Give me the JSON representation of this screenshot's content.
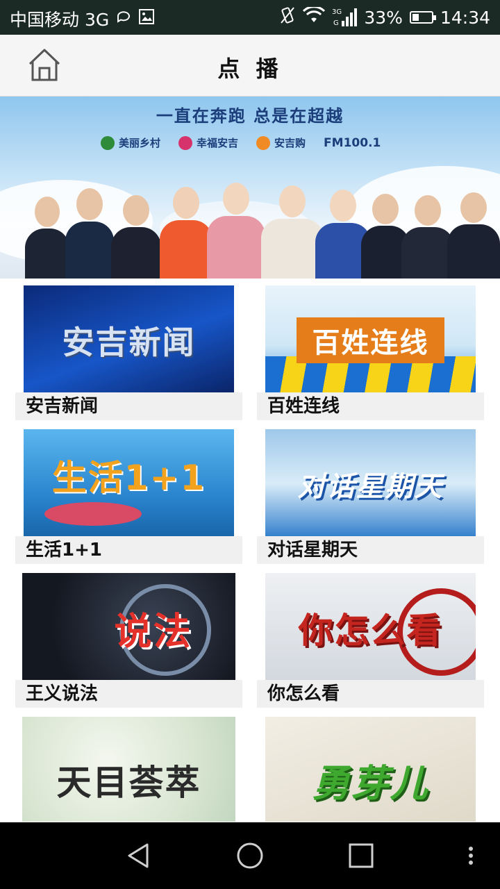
{
  "status_bar": {
    "carrier": "中国移动 3G",
    "network": "3G",
    "battery": "33%",
    "battery_level": 0.33,
    "time": "14:34",
    "icons": [
      "message-icon",
      "image-icon",
      "vibrate-icon",
      "wifi-icon",
      "signal-icon",
      "battery-icon"
    ]
  },
  "header": {
    "title": "点 播",
    "home_icon": "home-icon"
  },
  "banner": {
    "slogan": "一直在奔跑 总是在超越",
    "logos": [
      "美丽乡村",
      "幸福安吉",
      "安吉购",
      "FM100.1"
    ],
    "logo_colors": [
      "#2e8b3a",
      "#d6336c",
      "#f08a24"
    ]
  },
  "programs": [
    {
      "title": "安吉新闻",
      "thumb_text": "安吉新闻"
    },
    {
      "title": "百姓连线",
      "thumb_text": "百姓连线"
    },
    {
      "title": "生活1+1",
      "thumb_text": "生活1+1"
    },
    {
      "title": "对话星期天",
      "thumb_text": "对话星期天"
    },
    {
      "title": "王义说法",
      "thumb_text": "说法"
    },
    {
      "title": "你怎么看",
      "thumb_text": "你怎么看"
    },
    {
      "title": "",
      "thumb_text": "天目荟萃"
    },
    {
      "title": "",
      "thumb_text": "勇芽儿"
    }
  ],
  "nav": {
    "icons": [
      "back-icon",
      "home-circle-icon",
      "recents-icon",
      "more-icon"
    ]
  }
}
